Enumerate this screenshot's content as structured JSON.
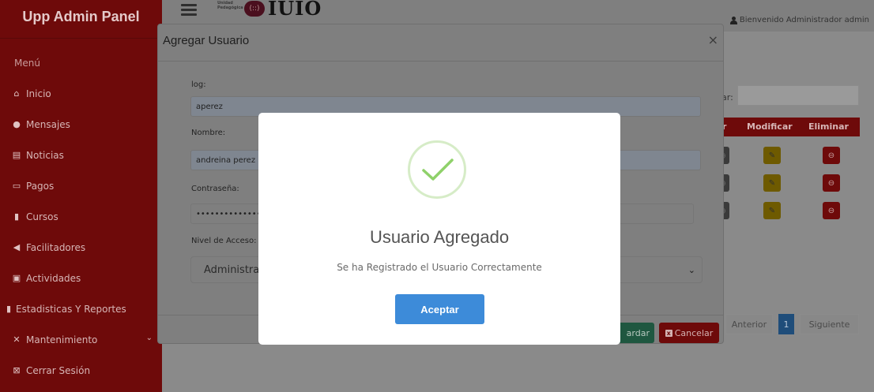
{
  "sidebar": {
    "brand": "Upp Admin Panel",
    "menu_title": "Menú",
    "items": [
      {
        "label": "Inicio",
        "icon": "home-icon"
      },
      {
        "label": "Mensajes",
        "icon": "chat-icon"
      },
      {
        "label": "Noticias",
        "icon": "newspaper-icon"
      },
      {
        "label": "Pagos",
        "icon": "money-icon"
      },
      {
        "label": "Cursos",
        "icon": "book-icon"
      },
      {
        "label": "Facilitadores",
        "icon": "bullhorn-icon"
      },
      {
        "label": "Actividades",
        "icon": "image-icon"
      },
      {
        "label": "Estadisticas Y Reportes",
        "icon": "file-icon"
      },
      {
        "label": "Mantenimiento",
        "icon": "tools-icon"
      },
      {
        "label": "Cerrar Sesión",
        "icon": "logout-icon"
      }
    ]
  },
  "header": {
    "logo_small": "Unidad\nPedagógica",
    "logo_mark": "(::)",
    "logo_text": "IUIO",
    "welcome": "Bienvenido Administrador admin"
  },
  "table": {
    "search_label": "ar:",
    "headers": [
      "r",
      "Modificar",
      "Eliminar"
    ],
    "pager": {
      "prev": "Anterior",
      "page": "1",
      "next": "Siguiente"
    }
  },
  "modal": {
    "title": "Agregar Usuario",
    "close": "×",
    "fields": [
      {
        "label": "log:",
        "value": "aperez"
      },
      {
        "label": "Nombre:",
        "value": "andreina perez"
      },
      {
        "label": "Contraseña:",
        "value": "••••••••••••••"
      },
      {
        "label": "Nivel de Acceso:",
        "value": "Administrador"
      }
    ],
    "save_label": "ardar",
    "cancel_label": "Cancelar",
    "cancel_icon_glyph": "x"
  },
  "alert": {
    "title": "Usuario Agregado",
    "text": "Se ha Registrado el Usuario Correctamente",
    "ok_label": "Aceptar",
    "accent": "#3d8bd9",
    "success_color": "#8fd16a"
  }
}
